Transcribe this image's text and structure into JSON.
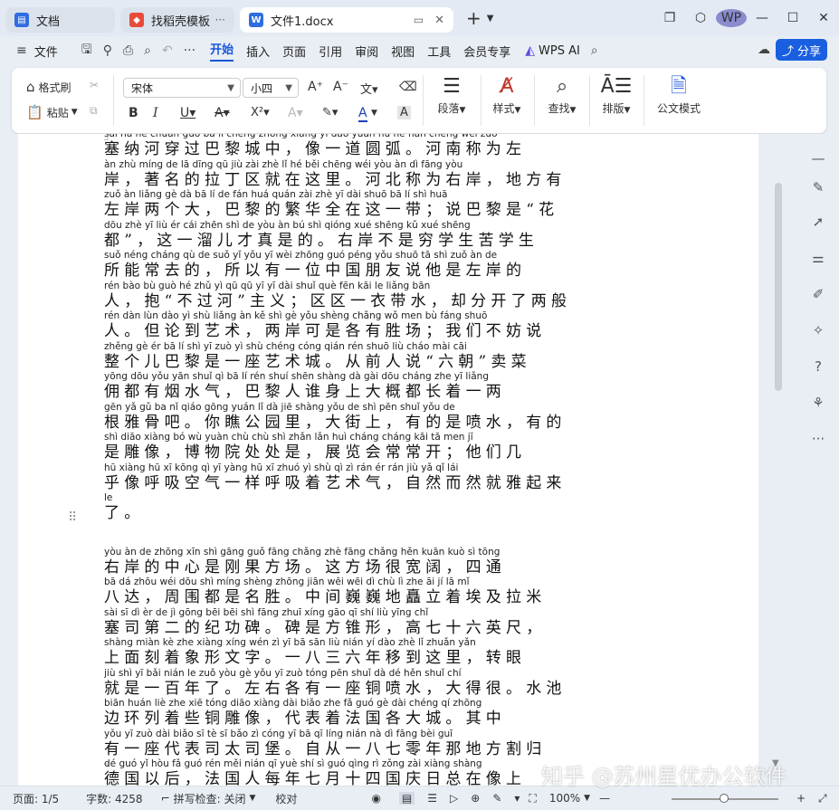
{
  "tabs": [
    {
      "label": "文档",
      "icon": "docs-icon",
      "color": "#2f6de0"
    },
    {
      "label": "找稻壳模板",
      "icon": "template-icon",
      "color": "#e84a3a"
    },
    {
      "label": "文件1.docx",
      "icon": "word-doc-icon",
      "color": "#2f6de0"
    }
  ],
  "new_tab": "+",
  "avatar_text": "WP",
  "menu": {
    "file": "文件",
    "items": [
      "开始",
      "插入",
      "页面",
      "引用",
      "审阅",
      "视图",
      "工具",
      "会员专享"
    ],
    "active": "开始",
    "ai": "WPS AI",
    "share": "分享"
  },
  "ribbon": {
    "format_painter": "格式刷",
    "paste": "粘贴",
    "font_name": "宋体",
    "font_size": "小四",
    "paragraph": "段落",
    "styles": "样式",
    "find": "查找",
    "layout": "排版",
    "official_mode": "公文模式"
  },
  "document": {
    "lines": [
      {
        "py": "sāi nà hé chuān guò bā lí chéng zhōng  xiàng yī dào yuán hú  hé nán chēng wéi zuǒ",
        "hz": "塞纳河穿过巴黎城中，像一道圆弧。河南称为左"
      },
      {
        "py": "àn  zhù míng de lā dīng qū jiù zài zhè lǐ   hé běi chēng wéi yòu àn   dì fāng yòu",
        "hz": "岸，著名的拉丁区就在这里。河北称为右岸，地方有"
      },
      {
        "py": "zuǒ àn liǎng gè dà   bā lí de fán huá quán zài zhè yī dài   shuō bā lí shì  huā",
        "hz": "左岸两个大，巴黎的繁华全在这一带；说巴黎是“花"
      },
      {
        "py": "dōu    zhè yī liù ér cái zhēn shì de   yòu àn bú shì qióng xué shēng kǔ xué shēng",
        "hz": "都”，这一溜儿才真是的。右岸不是穷学生苦学生"
      },
      {
        "py": "suǒ néng cháng qù de   suǒ yǐ yǒu yī wèi zhōng guó péng yǒu shuō tā shì zuǒ àn de",
        "hz": "所能常去的，所以有一位中国朋友说他是左岸的"
      },
      {
        "py": "rén   bào   bù guò hé   zhǔ yì   qū qū yī yī dài shuǐ   què fēn kāi le liǎng bān",
        "hz": "人，抱“不过河”主义；区区一衣带水，却分开了两般"
      },
      {
        "py": "rén   dàn lùn dào yì shù   liǎng àn kě shì gè yǒu shèng chǎng   wǒ men bù fáng shuō",
        "hz": "人。但论到艺术，两岸可是各有胜场；我们不妨说"
      },
      {
        "py": "zhěng gè ér bā lí shì yī zuò yì shù chéng   cóng qián rén shuō   liù cháo   mài cāi",
        "hz": "整个儿巴黎是一座艺术城。从前人说“六朝”卖菜"
      },
      {
        "py": "yōng dōu yǒu yān shuǐ qì   bā lí rén shuí shēn shàng dà gài dōu cháng zhe yī liǎng",
        "hz": "佣都有烟水气，巴黎人谁身上大概都长着一两"
      },
      {
        "py": "gēn yǎ gǔ ba   nǐ qiáo gōng yuán lǐ   dà jiē shàng   yǒu de shì pēn shuǐ   yǒu de",
        "hz": "根雅骨吧。你瞧公园里，大街上，有的是喷水，有的"
      },
      {
        "py": "shì diāo xiàng   bó wù yuàn chù chù shì   zhǎn lǎn huì cháng cháng kāi   tā men jī",
        "hz": "是雕像，博物院处处是，展览会常常开；他们几"
      },
      {
        "py": "hū xiàng hū xī kōng qì yī yàng hū xī zhuó yì shù qì   zì rán ér rán jiù yǎ qǐ lái",
        "hz": "乎像呼吸空气一样呼吸着艺术气，自然而然就雅起来"
      },
      {
        "py": "le",
        "hz": "了。"
      },
      {
        "gap": true
      },
      {
        "py": "yòu àn de zhōng xīn shì gāng guǒ fāng chǎng   zhè fāng chǎng hěn kuān kuò   sì tōng",
        "hz": "右岸的中心是刚果方场。这方场很宽阔，四通"
      },
      {
        "py": "bā dá   zhōu wéi dōu shì míng shèng   zhōng jiān wēi wēi dì chù lì zhe āi jí lā mǐ",
        "hz": "八达，周围都是名胜。中间巍巍地矗立着埃及拉米"
      },
      {
        "py": "sài sī dì èr de jì gōng bēi   bēi shì fāng zhuī xíng   gāo qī shí liù yīng chǐ",
        "hz": "塞司第二的纪功碑。碑是方锥形，高七十六英尺，"
      },
      {
        "py": "shàng miàn kè zhe xiàng xíng wén zì   yī bā sān liù nián yí dào zhè lǐ   zhuǎn yǎn",
        "hz": "上面刻着象形文字。一八三六年移到这里，转眼"
      },
      {
        "py": "jiù shì yī bǎi nián le   zuǒ yòu gè yǒu yī zuò tóng pēn shuǐ   dà dé hěn   shuǐ chí",
        "hz": "就是一百年了。左右各有一座铜喷水，大得很。水池"
      },
      {
        "py": "biān huán liè zhe xiē tóng diāo xiàng   dài biǎo zhe fǎ guó gè dài chéng   qí zhōng",
        "hz": "边环列着些铜雕像，代表着法国各大城。其中"
      },
      {
        "py": "yǒu yī zuò dài biǎo sī tè sī bǎo   zì cóng yī bā qī líng nián nà dì fāng bèi guī",
        "hz": "有一座代表司太司堡。自从一八七零年那地方割归"
      },
      {
        "py": "dé guó yǐ hòu   fǎ guó rén měi nián qī yuè shí sì guó qìng rì zǒng zài xiàng shàng",
        "hz": "德国以后，法国人每年七月十四国庆日总在像上"
      }
    ]
  },
  "status": {
    "page": "页面: 1/5",
    "words": "字数: 4258",
    "spell": "拼写检查: 关闭",
    "proof": "校对",
    "zoom": "100%",
    "zoom_level_percent": 100
  },
  "watermark": "知乎 @苏州星优办公软件"
}
